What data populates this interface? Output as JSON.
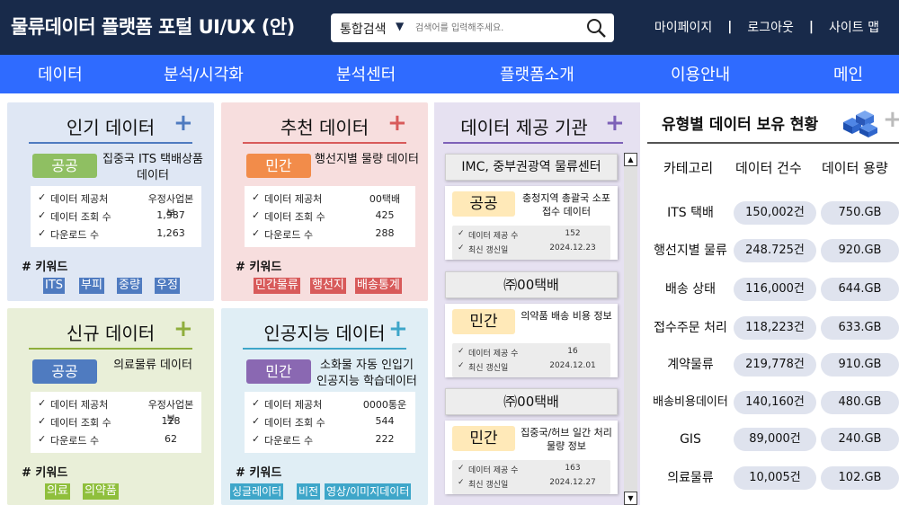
{
  "header": {
    "site_title": "물류데이터 플랫폼 포털 UI/UX (안)",
    "search_scope": "통합검색",
    "search_placeholder": "검색어를 입력해주세요.",
    "links": [
      "마이페이지",
      "로그아웃",
      "사이트 맵"
    ]
  },
  "nav": [
    "데이터",
    "분석/시각화",
    "분석센터",
    "플랫폼소개",
    "이용안내",
    "메인"
  ],
  "stat_labels": [
    "데이터 제공처",
    "데이터 조회 수",
    "다운로드 수"
  ],
  "keyword_title": "# 키워드",
  "cards": {
    "popular": {
      "title": "인기 데이터",
      "badge": "공공",
      "desc": "집중국 ITS 택배상품 데이터",
      "stats": [
        "우정사업본부",
        "1,987",
        "1,263"
      ],
      "keywords": [
        "ITS",
        "부피",
        "중량",
        "우정"
      ]
    },
    "recommended": {
      "title": "추천 데이터",
      "badge": "민간",
      "desc": "행선지별 물량 데이터",
      "stats": [
        "00택배",
        "425",
        "288"
      ],
      "keywords": [
        "민간물류",
        "행선지",
        "배송통계"
      ]
    },
    "new": {
      "title": "신규 데이터",
      "badge": "공공",
      "desc": "의료물류 데이터",
      "stats": [
        "우정사업본부",
        "128",
        "62"
      ],
      "keywords": [
        "의료",
        "의약품"
      ]
    },
    "ai": {
      "title": "인공지능 데이터",
      "badge": "민간",
      "desc": "소화물 자동 인입기 인공지능 학습데이터",
      "stats": [
        "0000통운",
        "544",
        "222"
      ],
      "keywords": [
        "싱글레이터",
        "비전",
        "영상/이미지데이터"
      ]
    }
  },
  "providers": {
    "title": "데이터 제공 기관",
    "stat_labels": [
      "데이터 제공 수",
      "최신 갱신일"
    ],
    "items": [
      {
        "name": "IMC, 중부권광역 물류센터",
        "badge": "공공",
        "desc": "충청지역 총괄국 소포접수 데이터",
        "count": "152",
        "date": "2024.12.23"
      },
      {
        "name": "㈜00택배",
        "badge": "민간",
        "desc": "의약품 배송 비용 정보",
        "count": "16",
        "date": "2024.12.01"
      },
      {
        "name": "㈜00택배",
        "badge": "민간",
        "desc": "집중국/허브 일간 처리 물량 정보",
        "count": "163",
        "date": "2024.12.27"
      }
    ]
  },
  "holdings": {
    "title": "유형별 데이터 보유 현황",
    "headers": [
      "카테고리",
      "데이터 건수",
      "데이터 용량"
    ],
    "rows": [
      {
        "category": "ITS 택배",
        "count": "150,002건",
        "size": "750.GB"
      },
      {
        "category": "행선지별 물류",
        "count": "248.725건",
        "size": "920.GB"
      },
      {
        "category": "배송 상태",
        "count": "116,000건",
        "size": "644.GB"
      },
      {
        "category": "접수주문 처리",
        "count": "118,223건",
        "size": "633.GB"
      },
      {
        "category": "계약물류",
        "count": "219,778건",
        "size": "910.GB"
      },
      {
        "category": "배송비용데이터",
        "count": "140,160건",
        "size": "480.GB"
      },
      {
        "category": "GIS",
        "count": "89,000건",
        "size": "240.GB"
      },
      {
        "category": "의료물류",
        "count": "10,005건",
        "size": "102.GB"
      }
    ]
  },
  "colors": {
    "header_bg": "#182a4a",
    "nav_bg": "#2f6bff",
    "blue_card": "#dfe7f4",
    "red_card": "#f7dede",
    "green_card": "#e9efd8",
    "cyan_card": "#e0eef5",
    "public_badge": "#4f7bc0",
    "private_badge": "#f28c4a",
    "green_badge": "#5a86c7",
    "purple_badge": "#8a68b2",
    "provider_bg": "#e6e1f1"
  },
  "icons": [
    "search-icon",
    "chevron-down-icon",
    "plus-icon",
    "check-icon",
    "server-stack-icon",
    "scroll-up-icon",
    "scroll-down-icon"
  ]
}
